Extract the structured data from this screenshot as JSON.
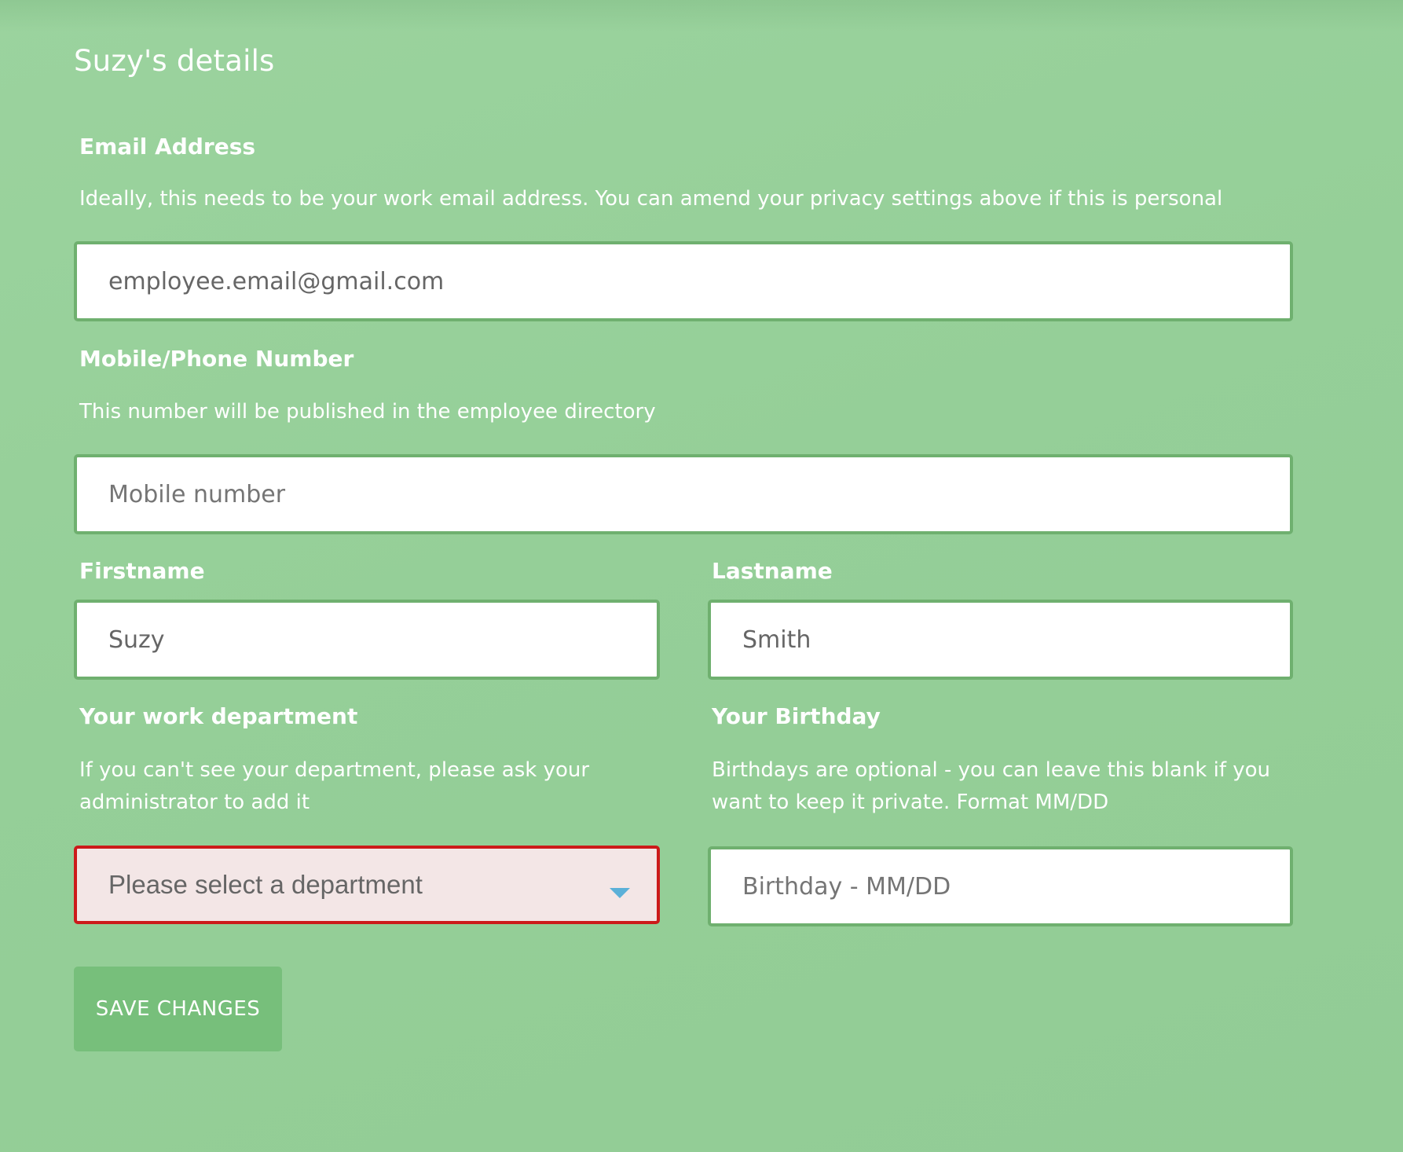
{
  "page": {
    "title": "Suzy's details"
  },
  "email": {
    "label": "Email Address",
    "help": "Ideally, this needs to be your work email address. You can amend your privacy settings above if this is personal",
    "value": "employee.email@gmail.com",
    "placeholder": ""
  },
  "phone": {
    "label": "Mobile/Phone Number",
    "help": "This number will be published in the employee directory",
    "value": "",
    "placeholder": "Mobile number"
  },
  "firstname": {
    "label": "Firstname",
    "value": "Suzy",
    "placeholder": ""
  },
  "lastname": {
    "label": "Lastname",
    "value": "Smith",
    "placeholder": ""
  },
  "department": {
    "label": "Your work department",
    "help_line1": "If you can't see your department, please ask your",
    "help_line2": "administrator to add it",
    "selected": "Please select a department"
  },
  "birthday": {
    "label": "Your Birthday",
    "help_line1": "Birthdays are optional - you can leave this blank if you",
    "help_line2": "want to keep it private. Format MM/DD",
    "value": "",
    "placeholder": "Birthday - MM/DD"
  },
  "actions": {
    "save_label": "SAVE CHANGES"
  },
  "colors": {
    "background": "#95cf98",
    "field_border": "#6fb06f",
    "error_border": "#cc1a1a",
    "error_fill": "#f3e6e6",
    "caret": "#5bb0d8",
    "button": "#77bf7b"
  },
  "icons": {
    "dropdown": "caret-down-icon"
  }
}
